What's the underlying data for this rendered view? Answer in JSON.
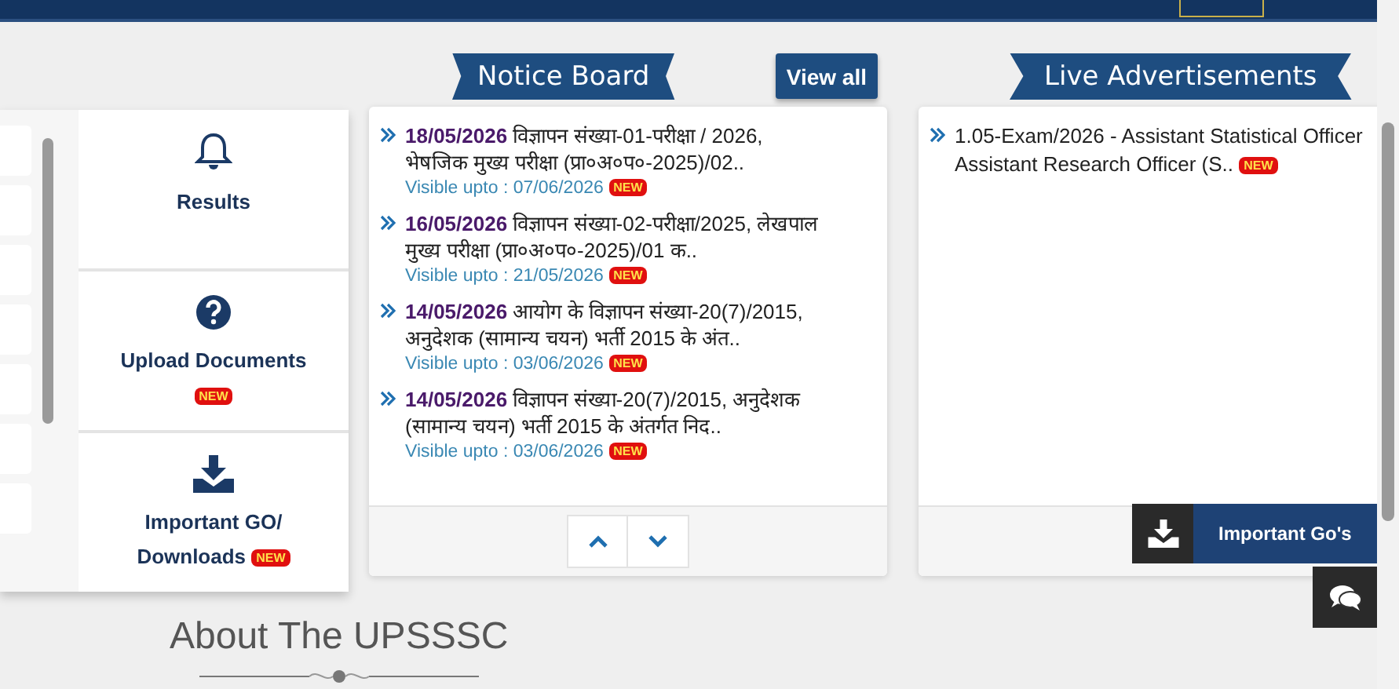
{
  "side_panel": {
    "tiles": [
      {
        "kind": "bell",
        "label": "Results"
      },
      {
        "kind": "question",
        "label": "Upload Documents",
        "badge": "NEW"
      },
      {
        "kind": "download",
        "label": "Important GO/ Downloads",
        "badge": "NEW"
      }
    ]
  },
  "notice_board": {
    "title": "Notice Board",
    "view_all": "View all",
    "items": [
      {
        "date": "18/05/2026",
        "text": "विज्ञापन संख्या-01-परीक्षा / 2026, भेषजिक मुख्य परीक्षा (प्रा०अ०प०-2025)/02..",
        "visible": "Visible upto : 07/06/2026",
        "badge": "NEW"
      },
      {
        "date": "16/05/2026",
        "text": "विज्ञापन संख्या-02-परीक्षा/2025, लेखपाल मुख्य परीक्षा (प्रा०अ०प०-2025)/01 क..",
        "visible": "Visible upto : 21/05/2026",
        "badge": "NEW"
      },
      {
        "date": "14/05/2026",
        "text": "आयोग के विज्ञापन संख्या-20(7)/2015, अनुदेशक (सामान्य चयन) भर्ती 2015 के अंत..",
        "visible": "Visible upto : 03/06/2026",
        "badge": "NEW"
      },
      {
        "date": "14/05/2026",
        "text": "विज्ञापन संख्या-20(7)/2015, अनुदेशक (सामान्य चयन) भर्ती 2015 के अंतर्गत निद..",
        "visible": "Visible upto : 03/06/2026",
        "badge": "NEW"
      }
    ]
  },
  "live_ads": {
    "title": "Live Advertisements",
    "items": [
      {
        "text": "1.05-Exam/2026 - Assistant Statistical Officer\nAssistant Research Officer (S..",
        "badge": "NEW"
      }
    ]
  },
  "floating": {
    "important_gos": "Important Go's"
  },
  "about": {
    "title": "About The UPSSSC"
  }
}
